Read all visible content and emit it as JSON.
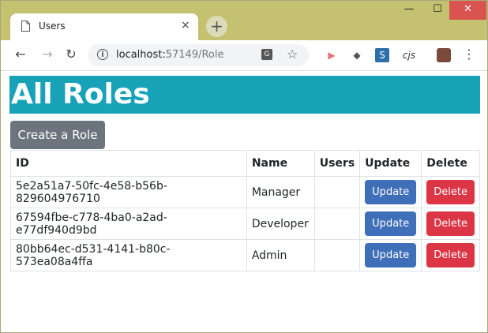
{
  "browser": {
    "tab_title": "Users",
    "tab_close": "×",
    "new_tab": "+",
    "window_controls": {
      "minimize": "—",
      "maximize": "☐",
      "close": "✕"
    },
    "back": "←",
    "forward": "→",
    "reload": "↻",
    "url_host": "localhost:",
    "url_path": "57149/Role",
    "star": "☆",
    "menu": "⋮",
    "extensions": [
      "cjs"
    ]
  },
  "page": {
    "title": "All Roles",
    "create_button": "Create a Role",
    "table": {
      "headers": [
        "ID",
        "Name",
        "Users",
        "Update",
        "Delete"
      ],
      "rows": [
        {
          "id": "5e2a51a7-50fc-4e58-b56b-829604976710",
          "name": "Manager",
          "users": "",
          "update": "Update",
          "delete": "Delete"
        },
        {
          "id": "67594fbe-c778-4ba0-a2ad-e77df940d9bd",
          "name": "Developer",
          "users": "",
          "update": "Update",
          "delete": "Delete"
        },
        {
          "id": "80bb64ec-d531-4141-b80c-573ea08a4ffa",
          "name": "Admin",
          "users": "",
          "update": "Update",
          "delete": "Delete"
        }
      ]
    }
  },
  "colors": {
    "titlebar": "#c4c170",
    "banner": "#17a2b8",
    "create_button": "#6c757d",
    "update_button": "#3f6fb8",
    "delete_button": "#dc3545",
    "close_button": "#d9534f"
  }
}
